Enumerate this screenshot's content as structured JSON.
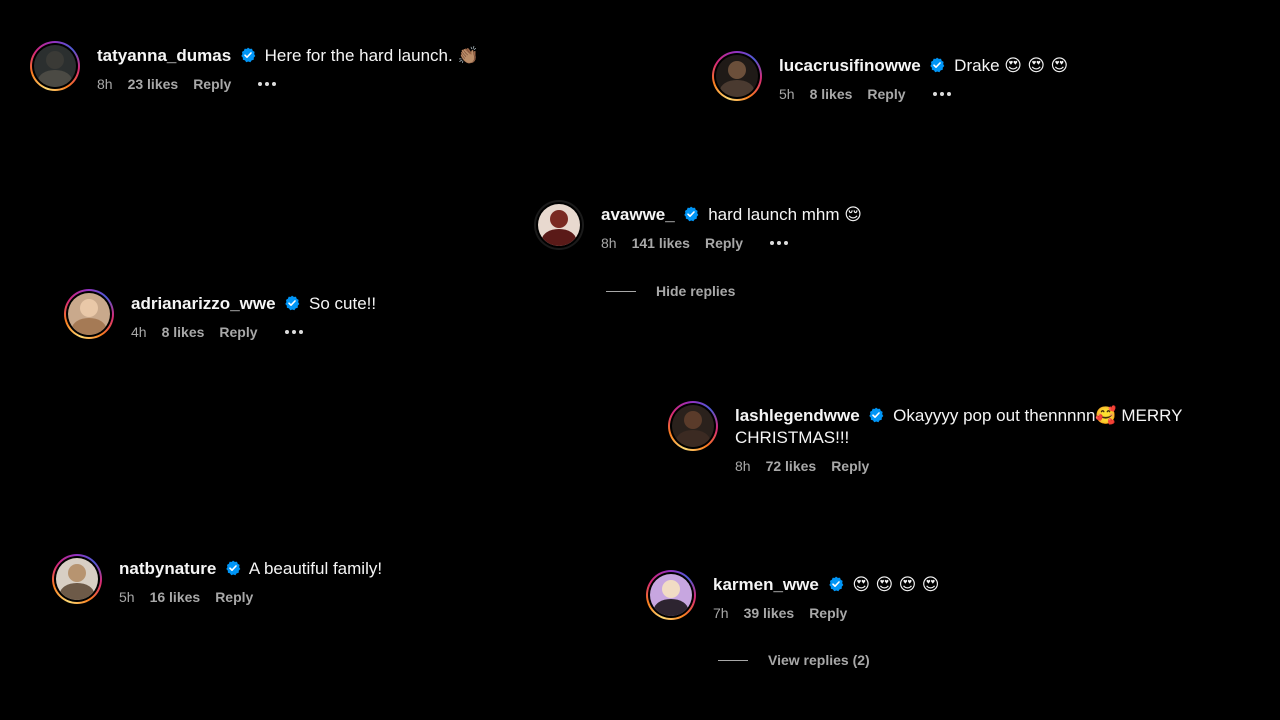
{
  "comments": [
    {
      "username": "tatyanna_dumas",
      "text": "Here for the hard launch.",
      "emoji": "👏🏽",
      "time": "8h",
      "likes": "23 likes",
      "reply": "Reply"
    },
    {
      "username": "lucacrusifinowwe",
      "text": "Drake",
      "emoji": "😍 😍 😍",
      "time": "5h",
      "likes": "8 likes",
      "reply": "Reply"
    },
    {
      "username": "avawwe_",
      "text": "hard launch mhm",
      "emoji": "😌",
      "time": "8h",
      "likes": "141 likes",
      "reply": "Reply"
    },
    {
      "username": "adrianarizzo_wwe",
      "text": "So cute!!",
      "time": "4h",
      "likes": "8 likes",
      "reply": "Reply"
    },
    {
      "username": "lashlegendwwe",
      "text": "Okayyyy pop out thennnnn",
      "emoji": "🥰",
      "text_after": "MERRY CHRISTMAS!!!",
      "time": "8h",
      "likes": "72 likes",
      "reply": "Reply"
    },
    {
      "username": "natbynature",
      "text": "A beautiful family!",
      "time": "5h",
      "likes": "16 likes",
      "reply": "Reply"
    },
    {
      "username": "karmen_wwe",
      "emoji": "😍 😍 😍 😍",
      "time": "7h",
      "likes": "39 likes",
      "reply": "Reply"
    }
  ],
  "toggles": {
    "hide_replies": "Hide replies",
    "view_replies": "View replies (2)"
  },
  "colors": {
    "background": "#000000",
    "text_primary": "#f5f5f5",
    "text_secondary": "#a8a8a8",
    "verified_blue": "#0095f6"
  },
  "icons": {
    "verified": "verified-badge-icon",
    "more": "more-options-icon"
  }
}
